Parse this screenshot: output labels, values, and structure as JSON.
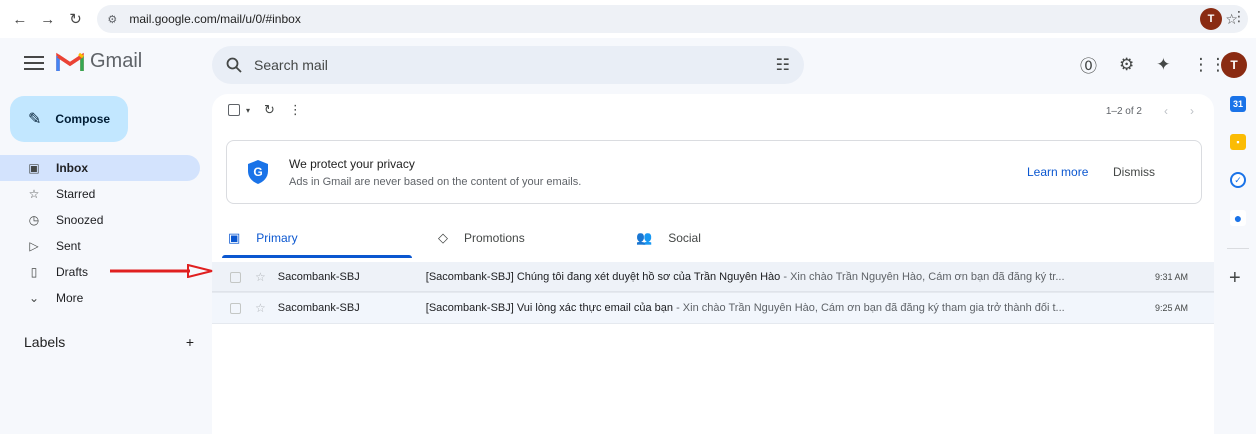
{
  "browser": {
    "url": "mail.google.com/mail/u/0/#inbox",
    "profile_initial": "T"
  },
  "app": {
    "name": "Gmail",
    "search_placeholder": "Search mail",
    "avatar_initial": "T"
  },
  "sidebar": {
    "compose_label": "Compose",
    "items": [
      {
        "label": "Inbox",
        "icon": "inbox-icon",
        "active": true
      },
      {
        "label": "Starred",
        "icon": "star-icon"
      },
      {
        "label": "Snoozed",
        "icon": "clock-icon"
      },
      {
        "label": "Sent",
        "icon": "send-icon"
      },
      {
        "label": "Drafts",
        "icon": "draft-icon"
      },
      {
        "label": "More",
        "icon": "chevron-down-icon"
      }
    ],
    "labels_title": "Labels"
  },
  "toolbar": {
    "pager_text": "1–2 of 2"
  },
  "privacy_banner": {
    "title": "We protect your privacy",
    "text": "Ads in Gmail are never based on the content of your emails.",
    "learn_more": "Learn more",
    "dismiss": "Dismiss"
  },
  "tabs": [
    {
      "label": "Primary",
      "icon": "inbox-icon",
      "active": true
    },
    {
      "label": "Promotions",
      "icon": "tag-icon"
    },
    {
      "label": "Social",
      "icon": "people-icon"
    }
  ],
  "emails": [
    {
      "sender": "Sacombank-SBJ",
      "subject": "[Sacombank-SBJ] Chúng tôi đang xét duyệt hồ sơ của Trần Nguyên Hào",
      "snippet": " - Xin chào Trần Nguyên Hào, Cám ơn bạn đã đăng ký tr...",
      "time": "9:31 AM"
    },
    {
      "sender": "Sacombank-SBJ",
      "subject": "[Sacombank-SBJ] Vui lòng xác thực email của bạn",
      "snippet": " - Xin chào Trần Nguyên Hào, Cám ơn bạn đã đăng ký tham gia trở thành đối t...",
      "time": "9:25 AM"
    }
  ],
  "colors": {
    "accent": "#0b57d0",
    "compose_bg": "#c2e7ff",
    "active_nav": "#d3e3fd",
    "annotation_arrow": "#e02020"
  }
}
